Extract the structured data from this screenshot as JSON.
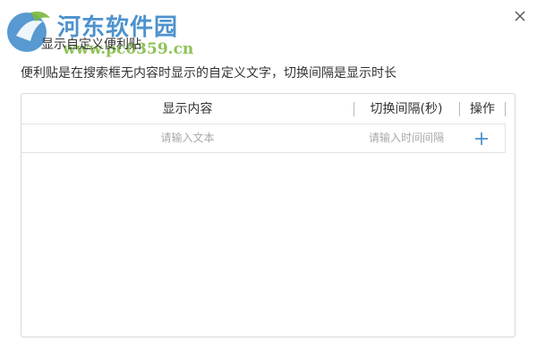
{
  "dialog": {
    "title": "显示自定义便利贴",
    "description": "便利贴是在搜索框无内容时显示的自定义文字，切换间隔是显示时长"
  },
  "table": {
    "columns": [
      "显示内容",
      "切换间隔(秒)",
      "操作"
    ],
    "new_row": {
      "content_placeholder": "请输入文本",
      "interval_placeholder": "请输入时间间隔",
      "content_value": "",
      "interval_value": ""
    }
  },
  "watermark": {
    "name": "河东软件园",
    "url": "www.pc0359.cn"
  },
  "icons": {
    "close": "close-icon",
    "add": "plus-icon",
    "logo": "hedong-logo-icon"
  },
  "colors": {
    "accent": "#3a87c8",
    "border": "#d8d8d8",
    "text": "#333333",
    "placeholder": "#a8a8a8"
  }
}
